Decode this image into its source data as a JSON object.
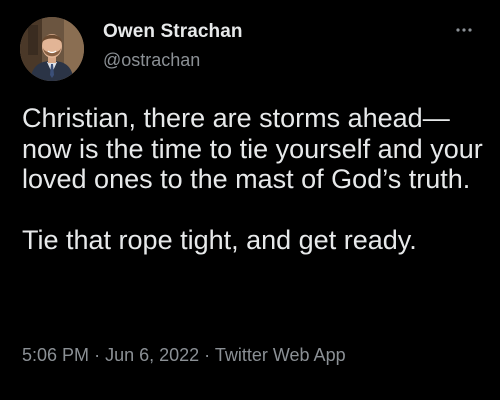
{
  "author": {
    "name": "Owen Strachan",
    "handle": "@ostrachan"
  },
  "tweet": {
    "paragraph1": "Christian, there are storms ahead—now is the time to tie yourself and your loved ones to the mast of God’s truth.",
    "paragraph2": "Tie that rope tight, and get ready."
  },
  "meta": {
    "time": "5:06 PM",
    "separator": "·",
    "date": "Jun 6, 2022",
    "source": "Twitter Web App"
  },
  "colors": {
    "background": "#000000",
    "primary_text": "#e7e9ea",
    "secondary_text": "#8b9095"
  },
  "icons": {
    "more": "more-horizontal-icon",
    "avatar": "profile-photo"
  }
}
